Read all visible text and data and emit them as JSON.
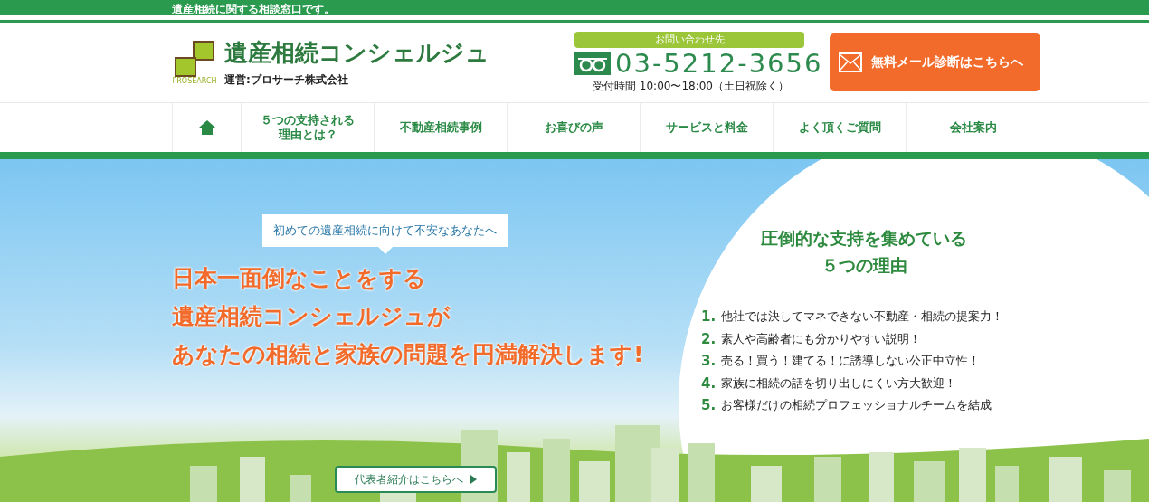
{
  "top_bar": {
    "text": "遺産相続に関する相談窓口です。"
  },
  "header": {
    "logo": {
      "title": "遺産相続コンシェルジュ",
      "subtitle": "運営:プロサーチ株式会社",
      "mark_text": "PROSEARCH"
    },
    "contact": {
      "label": "お問い合わせ先",
      "phone": "03-5212-3656",
      "hours": "受付時間 10:00〜18:00（土日祝除く）"
    },
    "mail_button": "無料メール診断はこちらへ"
  },
  "nav": {
    "items": [
      {
        "kind": "home"
      },
      {
        "kind": "text",
        "label": "５つの支持される理由とは？"
      },
      {
        "kind": "text",
        "label": "不動産相続事例"
      },
      {
        "kind": "text",
        "label": "お喜びの声"
      },
      {
        "kind": "text",
        "label": "サービスと料金"
      },
      {
        "kind": "text",
        "label": "よく頂くご質問"
      },
      {
        "kind": "text",
        "label": "会社案内"
      }
    ]
  },
  "hero": {
    "bubble": "初めての遺産相続に向けて不安なあなたへ",
    "headline": [
      "日本一面倒なことをする",
      "遺産相続コンシェルジュが",
      "あなたの相続と家族の問題を円満解決します!"
    ],
    "reasons": {
      "title": [
        "圧倒的な支持を集めている",
        "５つの理由"
      ],
      "items": [
        {
          "number": "1.",
          "text": "他社では決してマネできない不動産・相続の提案力！"
        },
        {
          "number": "2.",
          "text": "素人や高齢者にも分かりやすい説明！"
        },
        {
          "number": "3.",
          "text": "売る！買う！建てる！に誘導しない公正中立性！"
        },
        {
          "number": "4.",
          "text": "家族に相続の話を切り出しにくい方大歓迎！"
        },
        {
          "number": "5.",
          "text": "お客様だけの相続プロフェッショナルチームを結成"
        }
      ]
    },
    "button": "代表者紹介はこちらへ"
  }
}
